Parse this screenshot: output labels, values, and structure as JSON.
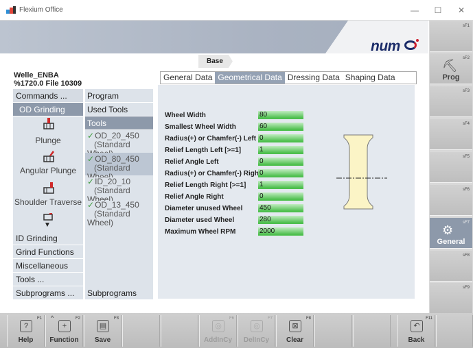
{
  "window": {
    "title": "Flexium Office",
    "minimize": "—",
    "maximize": "☐",
    "close": "✕"
  },
  "breadcrumb": "Base",
  "part": {
    "name": "Welle_ENBA",
    "file": "%1720.0 File 10309"
  },
  "commands": {
    "header": "Commands ...",
    "od_grinding": "OD Grinding",
    "plunge": "Plunge",
    "angular_plunge": "Angular Plunge",
    "shoulder_traverse": "Shoulder Traverse",
    "id_grinding": "ID Grinding",
    "grind_functions": "Grind Functions",
    "miscellaneous": "Miscellaneous",
    "tools": "Tools ...",
    "subprograms": "Subprograms ..."
  },
  "program": {
    "header": "Program",
    "used_tools": "Used Tools",
    "tools": "Tools",
    "items": [
      {
        "name": "OD_20_450",
        "type": "(Standard Wheel)"
      },
      {
        "name": "OD_80_450",
        "type": "(Standard Wheel)"
      },
      {
        "name": "ID_20_10",
        "type": "(Standard Wheel)"
      },
      {
        "name": "OD_13_450",
        "type": "(Standard Wheel)"
      }
    ],
    "subprograms": "Subprograms"
  },
  "tabs": [
    "General Data",
    "Geometrical Data",
    "Dressing Data",
    "Shaping Data"
  ],
  "fields": [
    {
      "label": "Wheel Width",
      "value": "80"
    },
    {
      "label": "Smallest Wheel Width",
      "value": "60"
    },
    {
      "label": "Radius(+) or Chamfer(-) Left",
      "value": "0"
    },
    {
      "label": "Relief Length Left [>=1]",
      "value": "1"
    },
    {
      "label": "Relief Angle Left",
      "value": "0"
    },
    {
      "label": "Radius(+) or Chamfer(-) Right",
      "value": "0"
    },
    {
      "label": "Relief Length Right [>=1]",
      "value": "1"
    },
    {
      "label": "Relief Angle Right",
      "value": "0"
    },
    {
      "label": "Diameter unused Wheel",
      "value": "450"
    },
    {
      "label": "Diameter used Wheel",
      "value": "280"
    },
    {
      "label": "Maximum Wheel RPM",
      "value": "2000"
    }
  ],
  "softkeys_side": [
    {
      "key": "sF1",
      "label": ""
    },
    {
      "key": "sF2",
      "label": "Prog"
    },
    {
      "key": "sF3",
      "label": ""
    },
    {
      "key": "sF4",
      "label": ""
    },
    {
      "key": "sF5",
      "label": ""
    },
    {
      "key": "sF6",
      "label": ""
    },
    {
      "key": "sF7",
      "label": "General"
    },
    {
      "key": "sF8",
      "label": ""
    },
    {
      "key": "sF9",
      "label": ""
    }
  ],
  "softkeys_bottom": [
    {
      "key": "F1",
      "label": "Help",
      "icon": "?"
    },
    {
      "key": "F2",
      "label": "Function",
      "icon": "+"
    },
    {
      "key": "F3",
      "label": "Save",
      "icon": "▤"
    },
    {
      "key": "F4",
      "label": "",
      "icon": ""
    },
    {
      "key": "F5",
      "label": "",
      "icon": ""
    },
    {
      "key": "F6",
      "label": "AddInCy",
      "icon": "◎"
    },
    {
      "key": "F7",
      "label": "DelInCy",
      "icon": "◎"
    },
    {
      "key": "F8",
      "label": "Clear",
      "icon": "⊠"
    },
    {
      "key": "F9",
      "label": "",
      "icon": ""
    },
    {
      "key": "F10",
      "label": "",
      "icon": ""
    },
    {
      "key": "F11",
      "label": "Back",
      "icon": "↶"
    }
  ],
  "logo": "num",
  "colors": {
    "accent": "#8d99aa",
    "field": "#4dbf4d",
    "logo": "#1a2b68"
  }
}
